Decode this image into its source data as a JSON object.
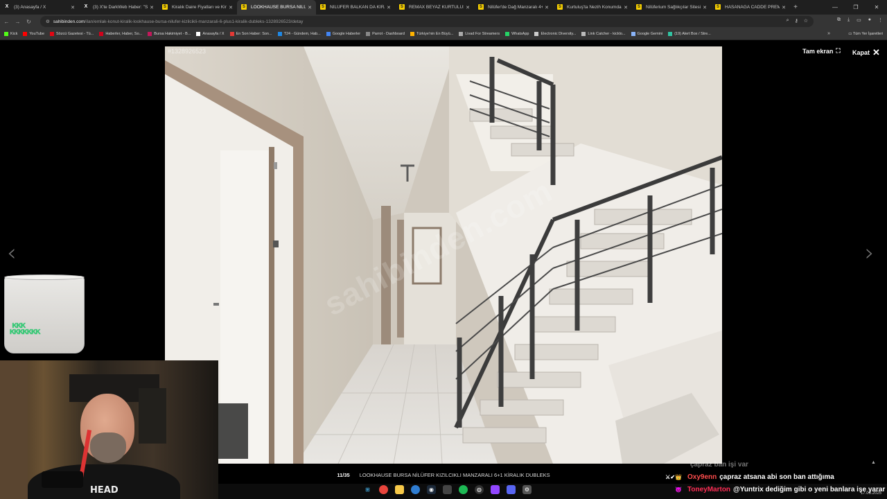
{
  "browser": {
    "tabs": [
      {
        "label": "(3) Anasayfa / X",
        "icon": "x-icon",
        "fav": "x",
        "glyph": "X"
      },
      {
        "label": "(3) X'te DarkWeb Haber: \"Sakarya...",
        "icon": "x-icon",
        "fav": "x",
        "glyph": "X"
      },
      {
        "label": "Kiralık Daire Fiyatları ve Kiralık...",
        "icon": "sahibinden-icon",
        "fav": "s",
        "glyph": "S"
      },
      {
        "label": "LOOKHAUSE BURSA NİLÜFER...",
        "icon": "sahibinden-icon",
        "fav": "s",
        "glyph": "S",
        "active": true
      },
      {
        "label": "NİLÜFER BALKAN DA KİRALIK...",
        "icon": "sahibinden-icon",
        "fav": "s",
        "glyph": "S"
      },
      {
        "label": "REMAX BEYAZ KURTULUŞ'TA...",
        "icon": "sahibinden-icon",
        "fav": "s",
        "glyph": "S"
      },
      {
        "label": "Nilüfer'de Dağ Manzaralı 4+1...",
        "icon": "sahibinden-icon",
        "fav": "s",
        "glyph": "S"
      },
      {
        "label": "Kurtuluş'ta Nezih Konumda...",
        "icon": "sahibinden-icon",
        "fav": "s",
        "glyph": "S"
      },
      {
        "label": "Nilüferium Sağlıkçılar Sitesi'nd...",
        "icon": "sahibinden-icon",
        "fav": "s",
        "glyph": "S"
      },
      {
        "label": "HASANAGA CADDE PREMIUM...",
        "icon": "sahibinden-icon",
        "fav": "s",
        "glyph": "S"
      }
    ],
    "url_host": "sahibinden.com",
    "url_path": "/ilan/emlak-konut-kiralik-lookhause-bursa-nilufer-kizilcikli-manzarali-6-plus1-kiralik-dubleks-1328926523/detay",
    "bookmarks": [
      {
        "label": "Kick",
        "color": "#53fc18"
      },
      {
        "label": "YouTube",
        "color": "#ff0000"
      },
      {
        "label": "Sözcü Gazetesi - Tü...",
        "color": "#e30613"
      },
      {
        "label": "Haberler, Haber, So...",
        "color": "#d0021b"
      },
      {
        "label": "Bursa Hakimiyet - B...",
        "color": "#c2185b"
      },
      {
        "label": "Anasayfa / X",
        "color": "#ffffff"
      },
      {
        "label": "En Son Haber: Son...",
        "color": "#e53935"
      },
      {
        "label": "T24 - Gündem, Hab...",
        "color": "#1e88e5"
      },
      {
        "label": "Google Haberler",
        "color": "#4285f4"
      },
      {
        "label": "Parrot - Dashboard",
        "color": "#888888"
      },
      {
        "label": "Türkiye'nin En Büyü...",
        "color": "#ffb300"
      },
      {
        "label": "Livad For Streamers",
        "color": "#aaaaaa"
      },
      {
        "label": "WhatsApp",
        "color": "#25d366"
      },
      {
        "label": "Electronic Diversity...",
        "color": "#cccccc"
      },
      {
        "label": "Link Catcher - kicklo...",
        "color": "#bbbbbb"
      },
      {
        "label": "Google Gemini",
        "color": "#8ab4f8"
      },
      {
        "label": "(19) Alert Box / Stre...",
        "color": "#31c3a2"
      }
    ],
    "all_bookmarks": "Tüm Yer İşaretleri"
  },
  "viewer": {
    "listing_id": "#1328926523",
    "watermark": "sahibinden.com",
    "fullscreen_label": "Tam ekran",
    "close_label": "Kapat",
    "counter": "11/35",
    "caption": "LOOKHAUSE BURSA NİLÜFER KIZILCIKLI MANZARALI 6+1 KİRALIK DUBLEKS"
  },
  "overlay": {
    "webcam_shirt": "HEAD",
    "chat": [
      {
        "user": "",
        "message": "çapraz ban işi var",
        "color": "#e74c3c",
        "faded": true,
        "badges": ""
      },
      {
        "user": "Oxy9enn",
        "message": "çapraz atsana abi son ban attığıma",
        "color": "#ff4d4d",
        "faded": false,
        "badges": "⚔✔👑"
      },
      {
        "user": "ToneyMarton",
        "message": "@Yuntrix dediğim gibi o yeni banlara işe yarar",
        "color": "#ff2d55",
        "faded": false,
        "badges": "😈"
      }
    ]
  },
  "taskbar": {
    "time": "",
    "date": "17.08.2025"
  },
  "colors": {
    "tab_active": "#353535",
    "tabbar": "#1f1f1f",
    "sahibinden_yellow": "#f7d000"
  }
}
